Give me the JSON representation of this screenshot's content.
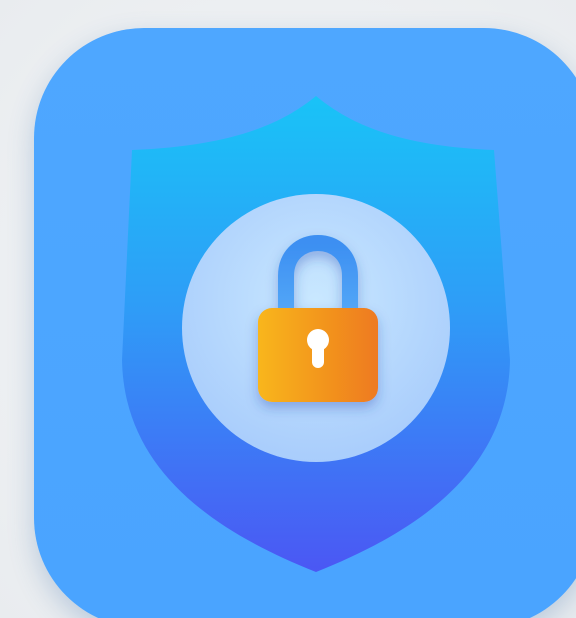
{
  "app_icon": {
    "name": "security-lock-app-icon",
    "icons": {
      "shield": "shield-icon",
      "lock": "padlock-icon",
      "keyhole": "keyhole-icon"
    },
    "colors": {
      "tile_background": "#4aa6ff",
      "shield_top": "#1fc0f8",
      "shield_bottom": "#4a5cf5",
      "inner_circle": "#bfe0ff",
      "lock_shackle": "#3f8ff0",
      "lock_body_start": "#f7b21f",
      "lock_body_end": "#f07a20",
      "keyhole": "#ffffff"
    }
  }
}
